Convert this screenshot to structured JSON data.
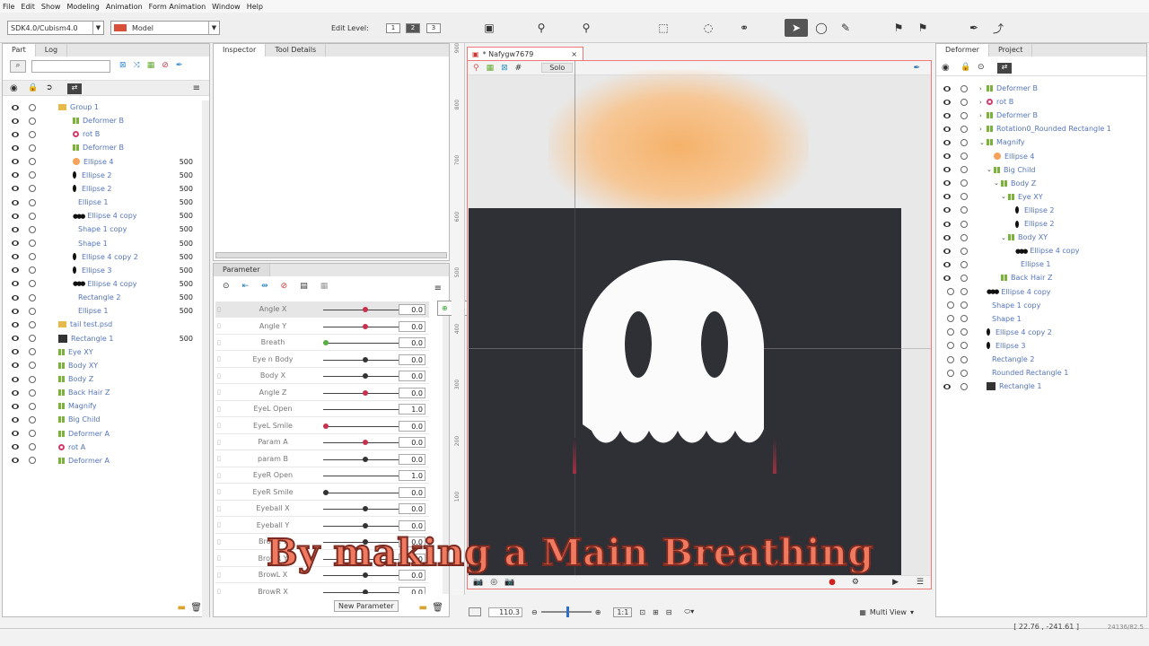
{
  "menu": [
    "File",
    "Edit",
    "Show",
    "Modeling",
    "Animation",
    "Form Animation",
    "Window",
    "Help"
  ],
  "toolbar": {
    "version": "SDK4.0/Cubism4.0",
    "model": "Model",
    "edit_level_label": "Edit Level:",
    "levels": [
      "1",
      "2",
      "3"
    ]
  },
  "left_tabs": [
    "Part",
    "Log"
  ],
  "parts": [
    {
      "name": "Group 1",
      "ico": "folder",
      "num": "",
      "indent": 0
    },
    {
      "name": "Deformer B",
      "ico": "grid",
      "num": "",
      "indent": 1
    },
    {
      "name": "rot B",
      "ico": "rot",
      "num": "",
      "indent": 1
    },
    {
      "name": "Deformer B",
      "ico": "grid",
      "num": "",
      "indent": 1
    },
    {
      "name": "Ellipse 4",
      "ico": "orange",
      "num": "500",
      "indent": 1
    },
    {
      "name": "Ellipse 2",
      "ico": "ell",
      "num": "500",
      "indent": 1
    },
    {
      "name": "Ellipse 2",
      "ico": "ell",
      "num": "500",
      "indent": 1
    },
    {
      "name": "Ellipse 1",
      "ico": "",
      "num": "500",
      "indent": 1
    },
    {
      "name": "Ellipse 4 copy",
      "ico": "ell3",
      "num": "500",
      "indent": 1
    },
    {
      "name": "Shape 1 copy",
      "ico": "",
      "num": "500",
      "indent": 1
    },
    {
      "name": "Shape 1",
      "ico": "",
      "num": "500",
      "indent": 1
    },
    {
      "name": "Ellipse 4 copy 2",
      "ico": "ell",
      "num": "500",
      "indent": 1
    },
    {
      "name": "Ellipse 3",
      "ico": "ell",
      "num": "500",
      "indent": 1
    },
    {
      "name": "Ellipse 4 copy",
      "ico": "ell3",
      "num": "500",
      "indent": 1
    },
    {
      "name": "Rectangle 2",
      "ico": "",
      "num": "500",
      "indent": 1
    },
    {
      "name": "Ellipse 1",
      "ico": "",
      "num": "500",
      "indent": 1
    },
    {
      "name": "tail test.psd",
      "ico": "folder",
      "num": "",
      "indent": 0
    },
    {
      "name": "Rectangle 1",
      "ico": "dark",
      "num": "500",
      "indent": 0
    },
    {
      "name": "Eye XY",
      "ico": "grid",
      "num": "",
      "indent": 0
    },
    {
      "name": "Body XY",
      "ico": "grid",
      "num": "",
      "indent": 0
    },
    {
      "name": "Body Z",
      "ico": "grid",
      "num": "",
      "indent": 0
    },
    {
      "name": "Back Hair Z",
      "ico": "grid",
      "num": "",
      "indent": 0
    },
    {
      "name": "Magnify",
      "ico": "grid",
      "num": "",
      "indent": 0
    },
    {
      "name": "Big Child",
      "ico": "grid",
      "num": "",
      "indent": 0
    },
    {
      "name": "Deformer A",
      "ico": "grid",
      "num": "",
      "indent": 0
    },
    {
      "name": "rot A",
      "ico": "rot",
      "num": "",
      "indent": 0
    },
    {
      "name": "Deformer A",
      "ico": "grid",
      "num": "",
      "indent": 0
    }
  ],
  "inspector_tabs": [
    "Inspector",
    "Tool Details"
  ],
  "param_tab": "Parameter",
  "params": [
    {
      "name": "Angle X",
      "val": "0.0",
      "pos": 0.5,
      "k": "red"
    },
    {
      "name": "Angle Y",
      "val": "0.0",
      "pos": 0.5,
      "k": "red"
    },
    {
      "name": "Breath",
      "val": "0.0",
      "pos": 0.0,
      "k": "grn"
    },
    {
      "name": "Eye n Body",
      "val": "0.0",
      "pos": 0.5,
      "k": ""
    },
    {
      "name": "Body X",
      "val": "0.0",
      "pos": 0.5,
      "k": ""
    },
    {
      "name": "Angle Z",
      "val": "0.0",
      "pos": 0.5,
      "k": "red"
    },
    {
      "name": "EyeL Open",
      "val": "1.0",
      "pos": 1.0,
      "k": "red"
    },
    {
      "name": "EyeL Smile",
      "val": "0.0",
      "pos": 0.0,
      "k": "red"
    },
    {
      "name": "Param A",
      "val": "0.0",
      "pos": 0.5,
      "k": "red"
    },
    {
      "name": "param B",
      "val": "0.0",
      "pos": 0.5,
      "k": ""
    },
    {
      "name": "EyeR Open",
      "val": "1.0",
      "pos": 1.0,
      "k": ""
    },
    {
      "name": "EyeR Smile",
      "val": "0.0",
      "pos": 0.0,
      "k": ""
    },
    {
      "name": "Eyeball X",
      "val": "0.0",
      "pos": 0.5,
      "k": ""
    },
    {
      "name": "Eyeball Y",
      "val": "0.0",
      "pos": 0.5,
      "k": ""
    },
    {
      "name": "BrowL Y",
      "val": "0.0",
      "pos": 0.5,
      "k": ""
    },
    {
      "name": "BrowR Y",
      "val": "0.0",
      "pos": 0.5,
      "k": ""
    },
    {
      "name": "BrowL X",
      "val": "0.0",
      "pos": 0.5,
      "k": ""
    },
    {
      "name": "BrowR X",
      "val": "0.0",
      "pos": 0.5,
      "k": ""
    }
  ],
  "new_param": "New Parameter",
  "canvas": {
    "tab": "* Nafygw7679",
    "solo": "Solo",
    "zoom": "110.3",
    "ratio": "1:1",
    "view": "Multi View"
  },
  "ruler": [
    "900",
    "800",
    "700",
    "600",
    "500",
    "400",
    "300",
    "200",
    "100"
  ],
  "caption": "By making a Main Breathing",
  "right_tabs": [
    "Deformer",
    "Project"
  ],
  "deformers": [
    {
      "name": "Deformer B",
      "ico": "grid",
      "i": 0,
      "exp": ">"
    },
    {
      "name": "rot B",
      "ico": "rot",
      "i": 0,
      "exp": ">"
    },
    {
      "name": "Deformer B",
      "ico": "grid",
      "i": 0,
      "exp": ">"
    },
    {
      "name": "Rotation0_Rounded Rectangle 1",
      "ico": "grid",
      "i": 0,
      "exp": ">"
    },
    {
      "name": "Magnify",
      "ico": "grid",
      "i": 0,
      "exp": "v"
    },
    {
      "name": "Ellipse 4",
      "ico": "orange",
      "i": 1,
      "exp": ""
    },
    {
      "name": "Big Child",
      "ico": "grid",
      "i": 1,
      "exp": "v"
    },
    {
      "name": "Body Z",
      "ico": "grid",
      "i": 2,
      "exp": "v"
    },
    {
      "name": "Eye XY",
      "ico": "grid",
      "i": 3,
      "exp": "v"
    },
    {
      "name": "Ellipse 2",
      "ico": "ell",
      "i": 4,
      "exp": ""
    },
    {
      "name": "Ellipse 2",
      "ico": "ell",
      "i": 4,
      "exp": ""
    },
    {
      "name": "Body XY",
      "ico": "grid",
      "i": 3,
      "exp": "v"
    },
    {
      "name": "Ellipse 4 copy",
      "ico": "ell3",
      "i": 4,
      "exp": ""
    },
    {
      "name": "Ellipse 1",
      "ico": "",
      "i": 4,
      "exp": ""
    },
    {
      "name": "Back Hair Z",
      "ico": "grid",
      "i": 2,
      "exp": ""
    },
    {
      "name": "Ellipse 4 copy",
      "ico": "ell3",
      "i": 0,
      "exp": ""
    },
    {
      "name": "Shape 1 copy",
      "ico": "",
      "i": 0,
      "exp": ""
    },
    {
      "name": "Shape 1",
      "ico": "",
      "i": 0,
      "exp": ""
    },
    {
      "name": "Ellipse 4 copy 2",
      "ico": "ell",
      "i": 0,
      "exp": ""
    },
    {
      "name": "Ellipse 3",
      "ico": "ell",
      "i": 0,
      "exp": ""
    },
    {
      "name": "Rectangle 2",
      "ico": "",
      "i": 0,
      "exp": ""
    },
    {
      "name": "Rounded Rectangle 1",
      "ico": "",
      "i": 0,
      "exp": ""
    },
    {
      "name": "Rectangle 1",
      "ico": "dark",
      "i": 0,
      "exp": ""
    }
  ],
  "coords": "[ 22.76 , -241.61 ]",
  "corner": "24136/82.5"
}
